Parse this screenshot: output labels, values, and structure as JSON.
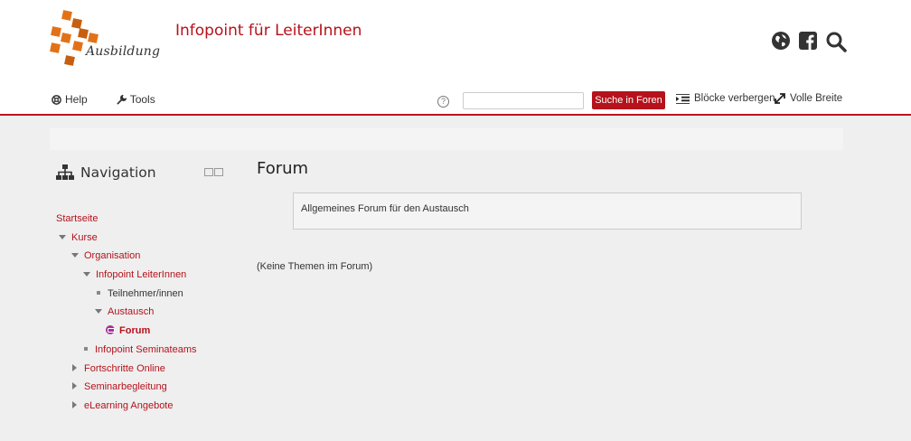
{
  "site": {
    "logo_text": "Ausbildung",
    "title": "Infopoint für LeiterInnen"
  },
  "header_icons": [
    "globe-icon",
    "facebook-icon",
    "search-icon"
  ],
  "navbar": {
    "help": "Help",
    "tools": "Tools",
    "search_placeholder": "",
    "search_button": "Suche in Foren",
    "hide_blocks": "Blöcke verbergen",
    "full_width": "Volle Breite"
  },
  "navigation": {
    "heading": "Navigation",
    "items": {
      "home": "Startseite",
      "courses": "Kurse",
      "organisation": "Organisation",
      "infopoint": "Infopoint LeiterInnen",
      "participants": "Teilnehmer/innen",
      "austausch": "Austausch",
      "forum": "Forum",
      "seminarteams": "Infopoint Seminateams",
      "progress": "Fortschritte Online",
      "seminar_support": "Seminarbegleitung",
      "elearning": "eLearning Angebote"
    }
  },
  "main": {
    "title": "Forum",
    "intro": "Allgemeines Forum für den Austausch",
    "empty_message": "(Keine Themen im Forum)"
  },
  "colors": {
    "accent": "#b5121b",
    "logo_orange": "#e27218",
    "forum_icon": "#a8329a"
  }
}
